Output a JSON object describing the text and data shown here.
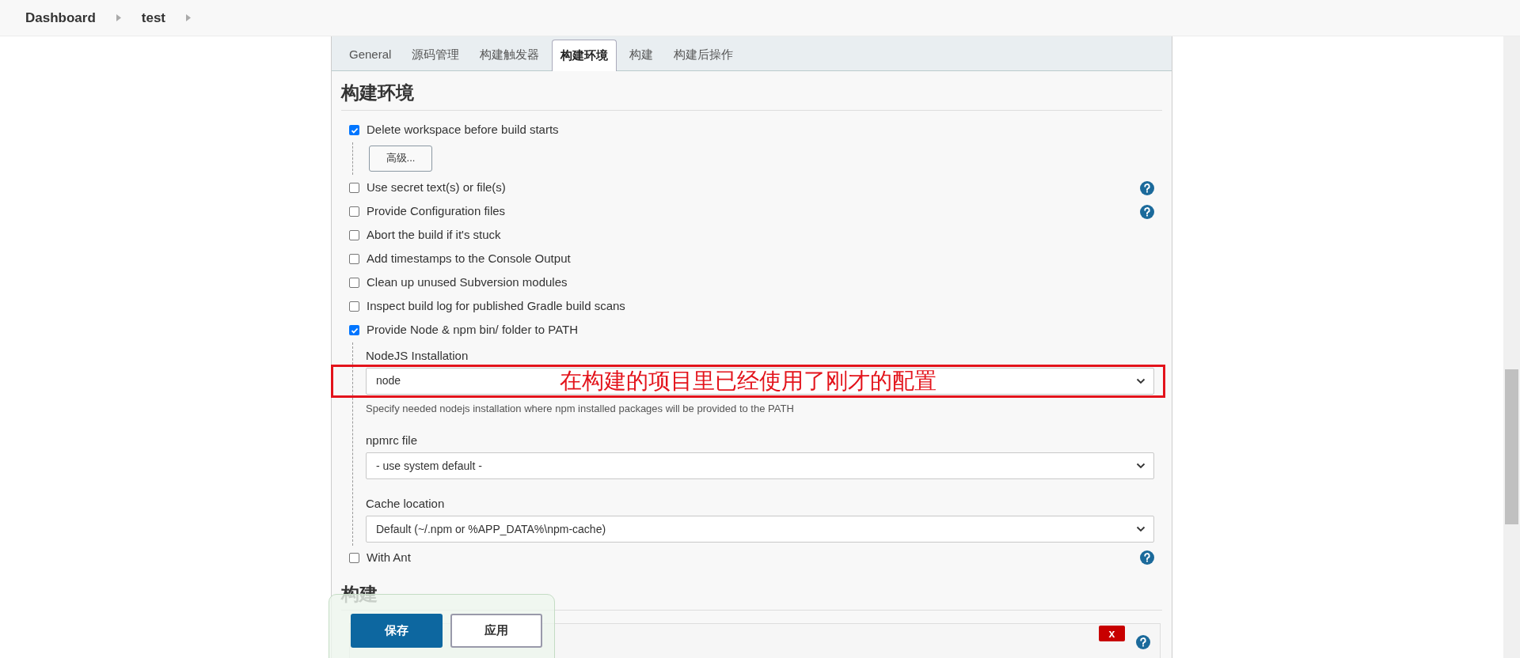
{
  "breadcrumbs": [
    {
      "label": "Dashboard"
    },
    {
      "label": "test"
    }
  ],
  "tabs": [
    {
      "label": "General",
      "selected": false
    },
    {
      "label": "源码管理",
      "selected": false
    },
    {
      "label": "构建触发器",
      "selected": false
    },
    {
      "label": "构建环境",
      "selected": true
    },
    {
      "label": "构建",
      "selected": false
    },
    {
      "label": "构建后操作",
      "selected": false
    }
  ],
  "section_title": "构建环境",
  "options": [
    {
      "label": "Delete workspace before build starts",
      "checked": true,
      "help": false,
      "advanced_button": "高级..."
    },
    {
      "label": "Use secret text(s) or file(s)",
      "checked": false,
      "help": true
    },
    {
      "label": "Provide Configuration files",
      "checked": false,
      "help": true
    },
    {
      "label": "Abort the build if it's stuck",
      "checked": false,
      "help": false
    },
    {
      "label": "Add timestamps to the Console Output",
      "checked": false,
      "help": false
    },
    {
      "label": "Clean up unused Subversion modules",
      "checked": false,
      "help": false
    },
    {
      "label": "Inspect build log for published Gradle build scans",
      "checked": false,
      "help": false
    },
    {
      "label": "Provide Node & npm bin/ folder to PATH",
      "checked": true,
      "help": false,
      "fields": [
        {
          "label": "NodeJS Installation",
          "value": "node",
          "hint": "Specify needed nodejs installation where npm installed packages will be provided to the PATH",
          "annotation": "在构建的项目里已经使用了刚才的配置"
        },
        {
          "label": "npmrc file",
          "value": "- use system default -"
        },
        {
          "label": "Cache location",
          "value": "Default (~/.npm or %APP_DATA%\\npm-cache)"
        }
      ]
    },
    {
      "label": "With Ant",
      "checked": false,
      "help": true
    }
  ],
  "next_section": {
    "title": "构建",
    "delete_label": "x"
  },
  "actions": [
    {
      "label": "保存",
      "kind": "primary"
    },
    {
      "label": "应用",
      "kind": "secondary"
    }
  ]
}
